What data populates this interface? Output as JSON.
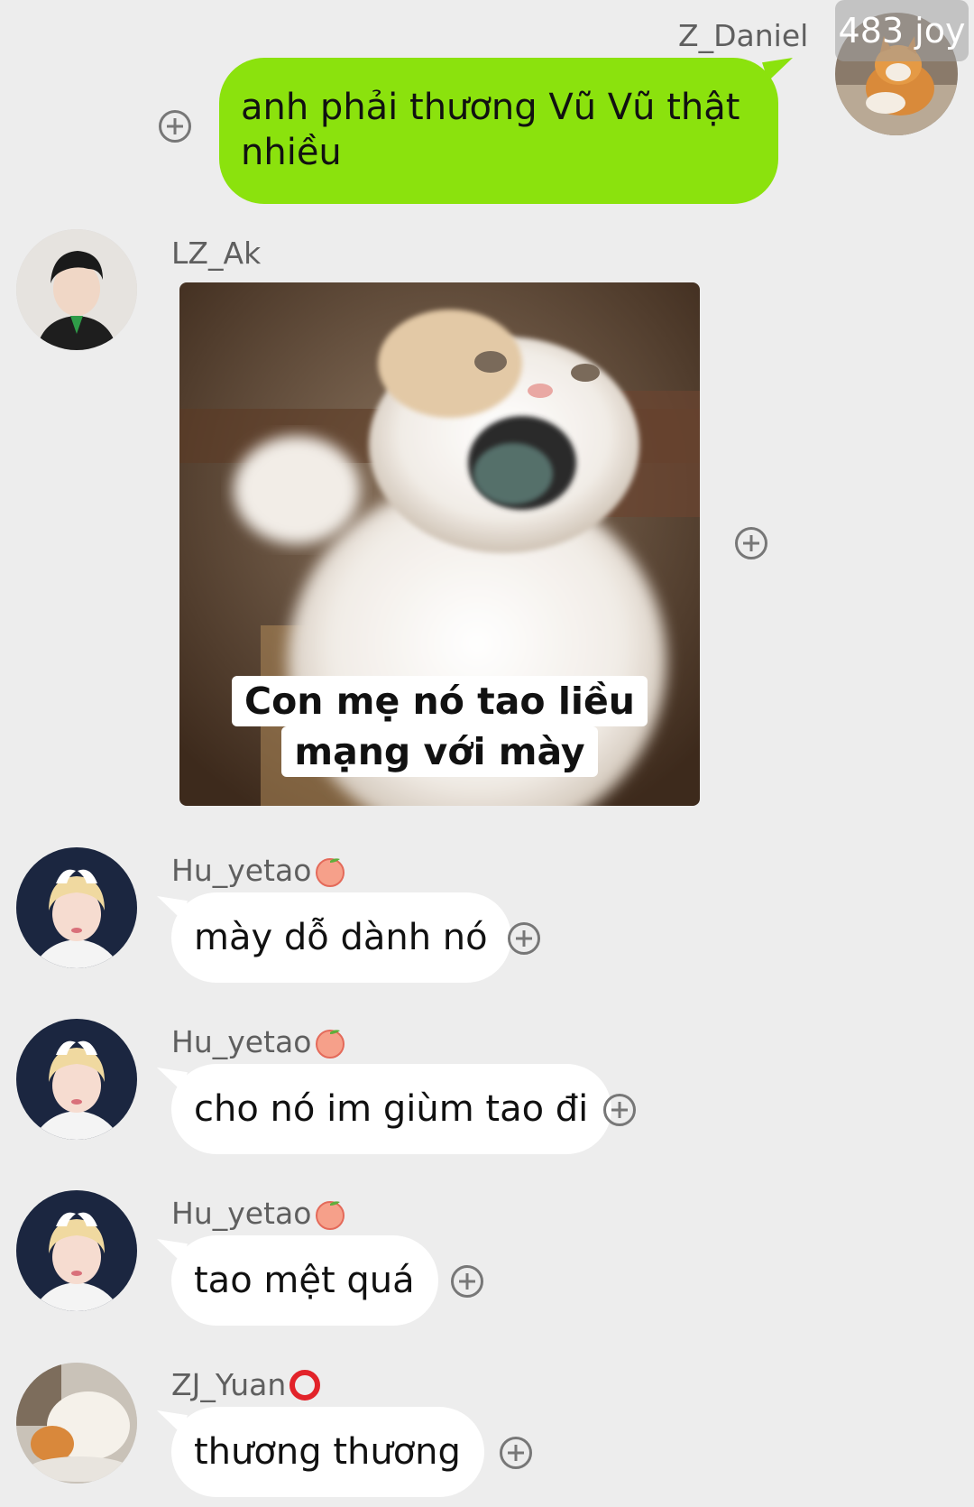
{
  "badge": {
    "text": "483 joy"
  },
  "messages": [
    {
      "sender": "Z_Daniel",
      "text": "anh phải thương Vũ Vũ thật nhiều",
      "avatar_icon": "cat-avatar-icon"
    },
    {
      "sender": "LZ_Ak",
      "type": "sticker",
      "caption_line1": "Con mẹ nó tao liều",
      "caption_line2": "mạng với mày",
      "avatar_icon": "person-avatar-icon"
    },
    {
      "sender": "Hu_yetao",
      "emoji": "peach",
      "text": "mày dỗ dành nó"
    },
    {
      "sender": "Hu_yetao",
      "emoji": "peach",
      "text": "cho nó im giùm tao đi"
    },
    {
      "sender": "Hu_yetao",
      "emoji": "peach",
      "text": "tao mệt quá"
    },
    {
      "sender": "ZJ_Yuan",
      "emoji": "red-circle",
      "text": "thương thương"
    }
  ],
  "colors": {
    "background": "#ededed",
    "own_bubble": "#8be20d",
    "other_bubble": "#ffffff",
    "username": "#5f5f5f"
  }
}
